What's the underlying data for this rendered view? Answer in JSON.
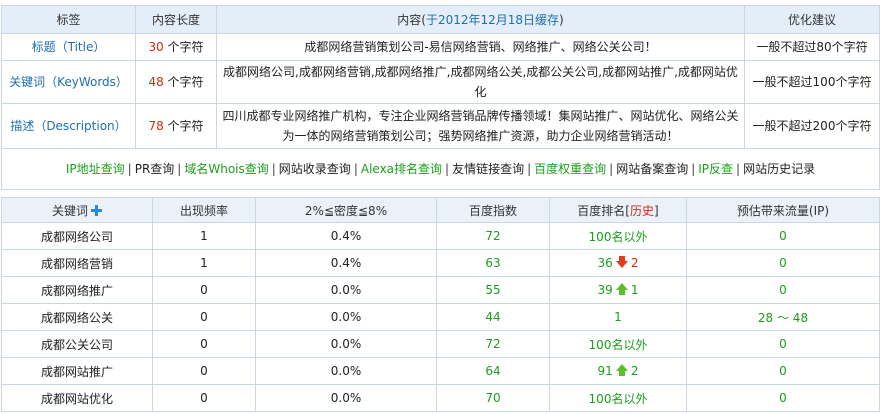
{
  "summary": {
    "headers": {
      "label": "标签",
      "length": "内容长度",
      "content_prefix": "内容(",
      "content_date": "于2012年12月18日缓存",
      "content_suffix": ")",
      "advice": "优化建议"
    },
    "rows": [
      {
        "label": "标题（Title）",
        "num": "30",
        "unit": " 个字符",
        "content": "成都网络营销策划公司-易信网络营销、网络推广、网络公关公司！",
        "advice": "一般不超过80个字符"
      },
      {
        "label": "关键词（KeyWords）",
        "num": "48",
        "unit": " 个字符",
        "content": "成都网络公司,成都网络营销,成都网络推广,成都网络公关,成都公关公司,成都网站推广,成都网站优化",
        "advice": "一般不超过100个字符"
      },
      {
        "label": "描述（Description）",
        "num": "78",
        "unit": " 个字符",
        "content": "四川成都专业网络推广机构，专注企业网络营销品牌传播领域！集网站推广、网站优化、网络公关为一体的网络营销策划公司；强势网络推广资源，助力企业网络营销活动！",
        "advice": "一般不超过200个字符"
      }
    ]
  },
  "links": [
    {
      "text": "IP地址查询",
      "color": "green"
    },
    {
      "text": "PR查询",
      "color": "dark"
    },
    {
      "text": "域名Whois查询",
      "color": "green"
    },
    {
      "text": "网站收录查询",
      "color": "dark"
    },
    {
      "text": "Alexa排名查询",
      "color": "green"
    },
    {
      "text": "友情链接查询",
      "color": "dark"
    },
    {
      "text": "百度权重查询",
      "color": "green"
    },
    {
      "text": "网站备案查询",
      "color": "dark"
    },
    {
      "text": "IP反查",
      "color": "green"
    },
    {
      "text": "网站历史记录",
      "color": "dark"
    }
  ],
  "keywords": {
    "headers": {
      "keyword": "关键词",
      "freq": "出现频率",
      "density": "2%≦密度≦8%",
      "index": "百度指数",
      "rank_prefix": "百度排名[",
      "rank_history": "历史",
      "rank_suffix": "]",
      "traffic": "预估带来流量(IP)"
    },
    "rows": [
      {
        "keyword": "成都网络公司",
        "freq": "1",
        "density": "0.4%",
        "index": "72",
        "rank": "100名以外",
        "trend": "",
        "change": "",
        "traffic": "0"
      },
      {
        "keyword": "成都网络营销",
        "freq": "1",
        "density": "0.4%",
        "index": "63",
        "rank": "36",
        "trend": "down",
        "change": "2",
        "traffic": "0"
      },
      {
        "keyword": "成都网络推广",
        "freq": "0",
        "density": "0.0%",
        "index": "55",
        "rank": "39",
        "trend": "up",
        "change": "1",
        "traffic": "0"
      },
      {
        "keyword": "成都网络公关",
        "freq": "0",
        "density": "0.0%",
        "index": "44",
        "rank": "1",
        "trend": "",
        "change": "",
        "traffic": "28 ～ 48"
      },
      {
        "keyword": "成都公关公司",
        "freq": "0",
        "density": "0.0%",
        "index": "72",
        "rank": "100名以外",
        "trend": "",
        "change": "",
        "traffic": "0"
      },
      {
        "keyword": "成都网站推广",
        "freq": "0",
        "density": "0.0%",
        "index": "64",
        "rank": "91",
        "trend": "up",
        "change": "2",
        "traffic": "0"
      },
      {
        "keyword": "成都网站优化",
        "freq": "0",
        "density": "0.0%",
        "index": "70",
        "rank": "100名以外",
        "trend": "",
        "change": "",
        "traffic": "0"
      }
    ]
  },
  "colors": {
    "green": "#1b9e1b",
    "red": "#d42b0e",
    "blue": "#1f6fb0",
    "header_bg": "#e4eef8",
    "border": "#c9d7e4"
  }
}
